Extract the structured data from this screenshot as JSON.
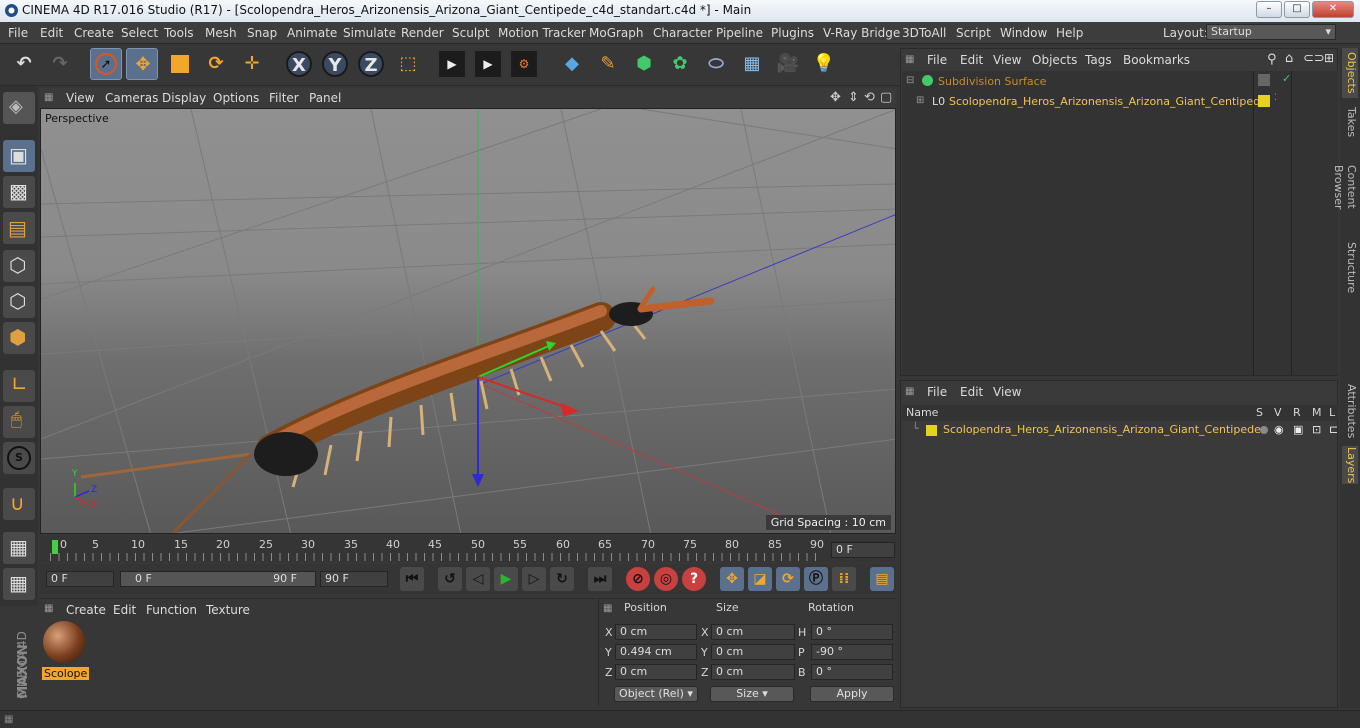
{
  "window": {
    "title": "CINEMA 4D R17.016 Studio (R17) - [Scolopendra_Heros_Arizonensis_Arizona_Giant_Centipede_c4d_standart.c4d *] - Main",
    "minimize": "–",
    "maximize": "□",
    "close": "✕"
  },
  "menubar": {
    "items": [
      "File",
      "Edit",
      "Create",
      "Select",
      "Tools",
      "Mesh",
      "Snap",
      "Animate",
      "Simulate",
      "Render",
      "Sculpt",
      "Motion Tracker",
      "MoGraph",
      "Character",
      "Pipeline",
      "Plugins",
      "V-Ray Bridge",
      "3DToAll",
      "Script",
      "Window",
      "Help"
    ],
    "layout_label": "Layout:",
    "layout_value": "Startup"
  },
  "toolbar": {
    "x_label": "X",
    "y_label": "Y",
    "z_label": "Z"
  },
  "viewport": {
    "menu": [
      "View",
      "Cameras",
      "Display",
      "Options",
      "Filter",
      "Panel"
    ],
    "name": "Perspective",
    "grid_spacing": "Grid Spacing : 10 cm",
    "axis_labels": [
      "Y",
      "Z",
      "X"
    ]
  },
  "timeline": {
    "ticks": [
      "0",
      "5",
      "10",
      "15",
      "20",
      "25",
      "30",
      "35",
      "40",
      "45",
      "50",
      "55",
      "60",
      "65",
      "70",
      "75",
      "80",
      "85",
      "90"
    ],
    "current_frame": "0 F"
  },
  "transport": {
    "start_frame": "0 F",
    "range_start": "0 F",
    "range_end": "90 F",
    "end_frame": "90 F"
  },
  "material_panel": {
    "menu": [
      "Create",
      "Edit",
      "Function",
      "Texture"
    ],
    "material_name": "Scolope"
  },
  "coords": {
    "headers": [
      "Position",
      "Size",
      "Rotation"
    ],
    "axis": [
      "X",
      "Y",
      "Z"
    ],
    "rot_axis": [
      "H",
      "P",
      "B"
    ],
    "position": [
      "0 cm",
      "0.494 cm",
      "0 cm"
    ],
    "size": [
      "0 cm",
      "0 cm",
      "0 cm"
    ],
    "rotation": [
      "0 °",
      "-90 °",
      "0 °"
    ],
    "mode": "Object (Rel)",
    "size_mode": "Size",
    "apply": "Apply"
  },
  "object_manager": {
    "menu": [
      "File",
      "Edit",
      "View",
      "Objects",
      "Tags",
      "Bookmarks"
    ],
    "objects": [
      "Subdivision Surface",
      "Scolopendra_Heros_Arizonensis_Arizona_Giant_Centipede"
    ],
    "child_prefix": "L0"
  },
  "layer_manager": {
    "menu": [
      "File",
      "Edit",
      "View"
    ],
    "name_header": "Name",
    "cols": [
      "S",
      "V",
      "R",
      "M",
      "L"
    ],
    "layers": [
      "Scolopendra_Heros_Arizonensis_Arizona_Giant_Centipede"
    ]
  },
  "side_tabs": [
    "Objects",
    "Takes",
    "Content Browser",
    "Structure",
    "Attributes",
    "Layers"
  ],
  "brand": {
    "maxon": "MAXON",
    "product": "CINEMA 4D"
  },
  "colors": {
    "accent": "#f0c64a",
    "layer_yellow": "#e6d21e",
    "selection": "#5b708c"
  }
}
